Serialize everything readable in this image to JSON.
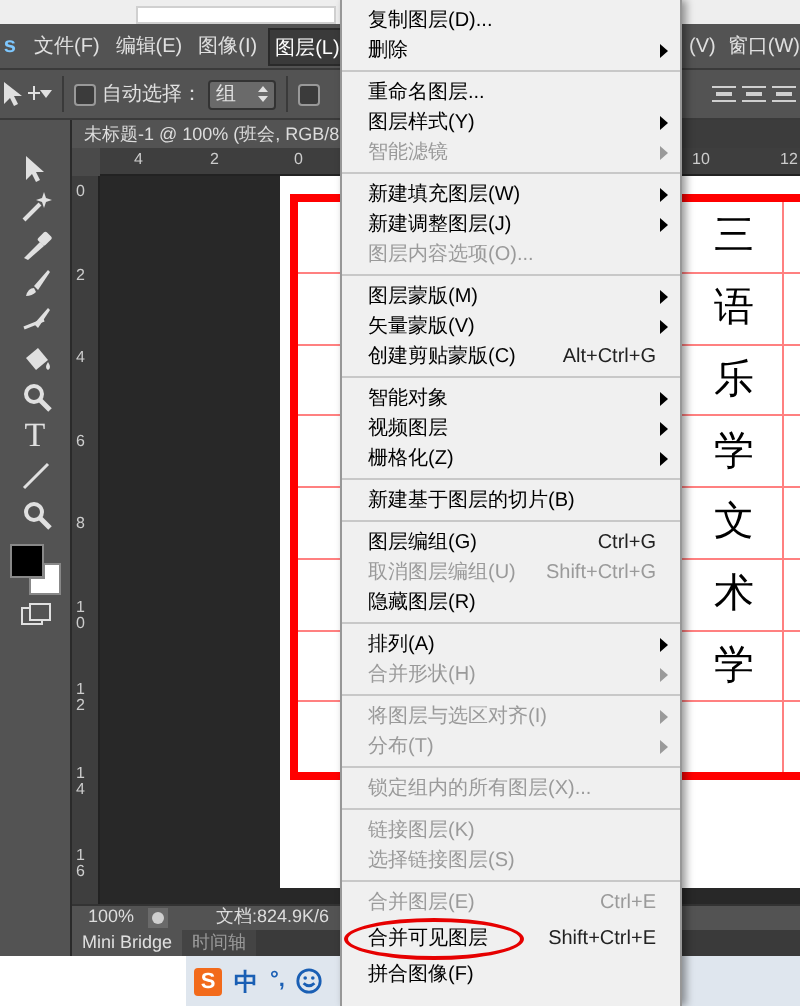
{
  "menu_bar": {
    "logo": "s",
    "items": [
      {
        "label": "文件(F)",
        "selected": false
      },
      {
        "label": "编辑(E)",
        "selected": false
      },
      {
        "label": "图像(I)",
        "selected": false
      },
      {
        "label": "图层(L)",
        "selected": true
      }
    ],
    "right_items": [
      "(V)",
      "窗口(W)"
    ]
  },
  "options_bar": {
    "auto_select": {
      "label": "自动选择：",
      "checked": false
    },
    "dropdown": "组",
    "second_checkbox": {
      "checked": false
    }
  },
  "document_tab": "未标题-1 @ 100% (班会, RGB/8",
  "top_ruler": [
    "4",
    "2",
    "0",
    "10",
    "12"
  ],
  "left_ruler": [
    "0",
    "2",
    "4",
    "6",
    "8",
    "10",
    "12",
    "14",
    "16"
  ],
  "tools": {
    "text_tool": "T"
  },
  "table": {
    "cells": [
      "三",
      "语",
      "乐",
      "学",
      "文",
      "术",
      "学",
      ""
    ]
  },
  "status_bar": {
    "zoom": "100%",
    "doc_info": "文档:824.9K/6"
  },
  "panel_tabs": [
    {
      "label": "Mini Bridge",
      "selected": true
    },
    {
      "label": "时间轴",
      "selected": false
    }
  ],
  "ime": {
    "logo": "S",
    "mode": "中",
    "punct": "°,"
  },
  "layer_menu": [
    {
      "kind": "item",
      "label": "复制图层(D)...",
      "disabled": false,
      "submenu": false
    },
    {
      "kind": "item",
      "label": "删除",
      "disabled": false,
      "submenu": true
    },
    {
      "kind": "separator"
    },
    {
      "kind": "item",
      "label": "重命名图层...",
      "disabled": false,
      "submenu": false
    },
    {
      "kind": "item",
      "label": "图层样式(Y)",
      "disabled": false,
      "submenu": true
    },
    {
      "kind": "item",
      "label": "智能滤镜",
      "disabled": true,
      "submenu": true
    },
    {
      "kind": "separator"
    },
    {
      "kind": "item",
      "label": "新建填充图层(W)",
      "disabled": false,
      "submenu": true
    },
    {
      "kind": "item",
      "label": "新建调整图层(J)",
      "disabled": false,
      "submenu": true
    },
    {
      "kind": "item",
      "label": "图层内容选项(O)...",
      "disabled": true,
      "submenu": false
    },
    {
      "kind": "separator"
    },
    {
      "kind": "item",
      "label": "图层蒙版(M)",
      "disabled": false,
      "submenu": true
    },
    {
      "kind": "item",
      "label": "矢量蒙版(V)",
      "disabled": false,
      "submenu": true
    },
    {
      "kind": "item",
      "label": "创建剪贴蒙版(C)",
      "shortcut": "Alt+Ctrl+G",
      "disabled": false,
      "submenu": false
    },
    {
      "kind": "separator"
    },
    {
      "kind": "item",
      "label": "智能对象",
      "disabled": false,
      "submenu": true
    },
    {
      "kind": "item",
      "label": "视频图层",
      "disabled": false,
      "submenu": true
    },
    {
      "kind": "item",
      "label": "栅格化(Z)",
      "disabled": false,
      "submenu": true
    },
    {
      "kind": "separator"
    },
    {
      "kind": "item",
      "label": "新建基于图层的切片(B)",
      "disabled": false,
      "submenu": false
    },
    {
      "kind": "separator"
    },
    {
      "kind": "item",
      "label": "图层编组(G)",
      "shortcut": "Ctrl+G",
      "disabled": false,
      "submenu": false
    },
    {
      "kind": "item",
      "label": "取消图层编组(U)",
      "shortcut": "Shift+Ctrl+G",
      "disabled": true,
      "submenu": false
    },
    {
      "kind": "item",
      "label": "隐藏图层(R)",
      "disabled": false,
      "submenu": false
    },
    {
      "kind": "separator"
    },
    {
      "kind": "item",
      "label": "排列(A)",
      "disabled": false,
      "submenu": true
    },
    {
      "kind": "item",
      "label": "合并形状(H)",
      "disabled": true,
      "submenu": true
    },
    {
      "kind": "separator"
    },
    {
      "kind": "item",
      "label": "将图层与选区对齐(I)",
      "disabled": true,
      "submenu": true
    },
    {
      "kind": "item",
      "label": "分布(T)",
      "disabled": true,
      "submenu": true
    },
    {
      "kind": "separator"
    },
    {
      "kind": "item",
      "label": "锁定组内的所有图层(X)...",
      "disabled": true,
      "submenu": false
    },
    {
      "kind": "separator"
    },
    {
      "kind": "item",
      "label": "链接图层(K)",
      "disabled": true,
      "submenu": false
    },
    {
      "kind": "item",
      "label": "选择链接图层(S)",
      "disabled": true,
      "submenu": false
    },
    {
      "kind": "separator"
    },
    {
      "kind": "item",
      "label": "合并图层(E)",
      "shortcut": "Ctrl+E",
      "disabled": true,
      "submenu": false
    },
    {
      "kind": "item",
      "label": "合并可见图层",
      "shortcut": "Shift+Ctrl+E",
      "disabled": false,
      "submenu": false,
      "circled": true
    },
    {
      "kind": "item",
      "label": "拼合图像(F)",
      "disabled": false,
      "submenu": false
    }
  ]
}
